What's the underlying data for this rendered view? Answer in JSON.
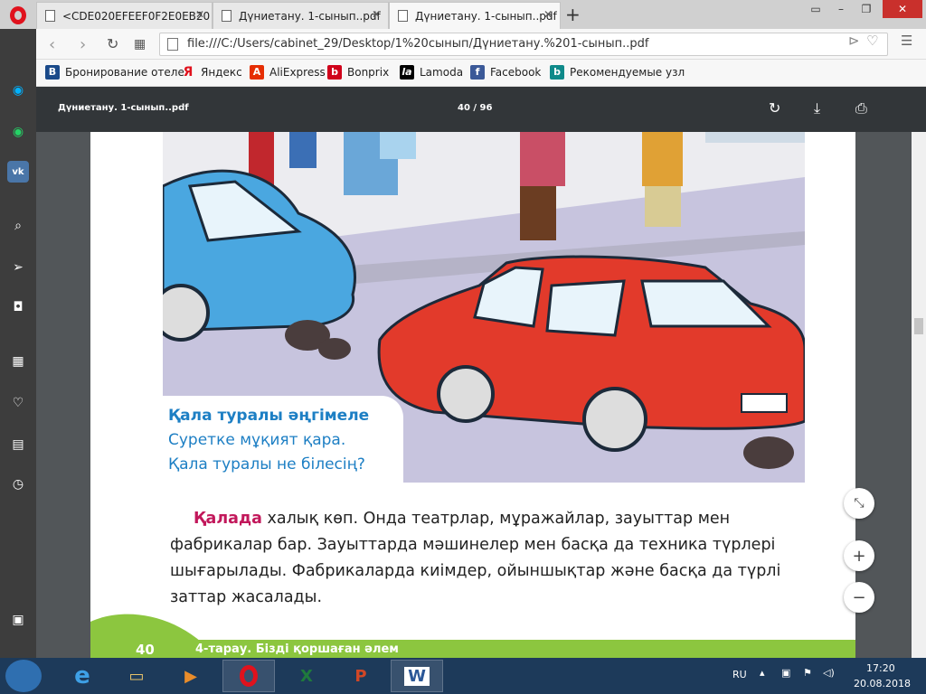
{
  "browser": {
    "tabs": [
      {
        "title": "<CDE020EFEEF0F2E0EB20"
      },
      {
        "title": "Дүниетану. 1-сынып..pdf"
      },
      {
        "title": "Дүниетану. 1-сынып..pdf"
      }
    ],
    "address": "file:///C:/Users/cabinet_29/Desktop/1%20сынып/Дүниетану.%201-сынып..pdf",
    "bookmarks": [
      {
        "label": "Бронирование отеле",
        "icon": "booking-icon",
        "color": "#1a4a8a",
        "glyph": "B"
      },
      {
        "label": "Яндекс",
        "icon": "yandex-icon",
        "color": "#ffffff",
        "glyph": "Я"
      },
      {
        "label": "AliExpress",
        "icon": "aliexpress-icon",
        "color": "#e62e04",
        "glyph": "A"
      },
      {
        "label": "Bonprix",
        "icon": "bonprix-icon",
        "color": "#d0021b",
        "glyph": "b"
      },
      {
        "label": "Lamoda",
        "icon": "lamoda-icon",
        "color": "#000000",
        "glyph": "la"
      },
      {
        "label": "Facebook",
        "icon": "facebook-icon",
        "color": "#3b5998",
        "glyph": "f"
      },
      {
        "label": "Рекомендуемые узл",
        "icon": "bing-icon",
        "color": "#0f8a8a",
        "glyph": "b"
      }
    ]
  },
  "pdf": {
    "title": "Дүниетану. 1-сынып..pdf",
    "page_current": "40",
    "page_sep": "/",
    "page_total": "96",
    "callout": {
      "heading": "Қала туралы әңгімеле",
      "line1": "Суретке мұқият қара.",
      "line2": "Қала туралы не білесің?"
    },
    "body": {
      "highlight": "Қалада",
      "text": " халық көп. Онда театрлар, мұражайлар, зауыттар мен фабрикалар бар. Зауыттарда мәшинелер мен басқа да техника түрлері шығарылады. Фабрикаларда киімдер, ойыншықтар және басқа да түрлі заттар жасалады."
    },
    "footer": {
      "page_number": "40",
      "chapter": "4-тарау. Бізді қоршаған әлем"
    }
  },
  "taskbar": {
    "lang": "RU",
    "time": "17:20",
    "date": "20.08.2018"
  }
}
